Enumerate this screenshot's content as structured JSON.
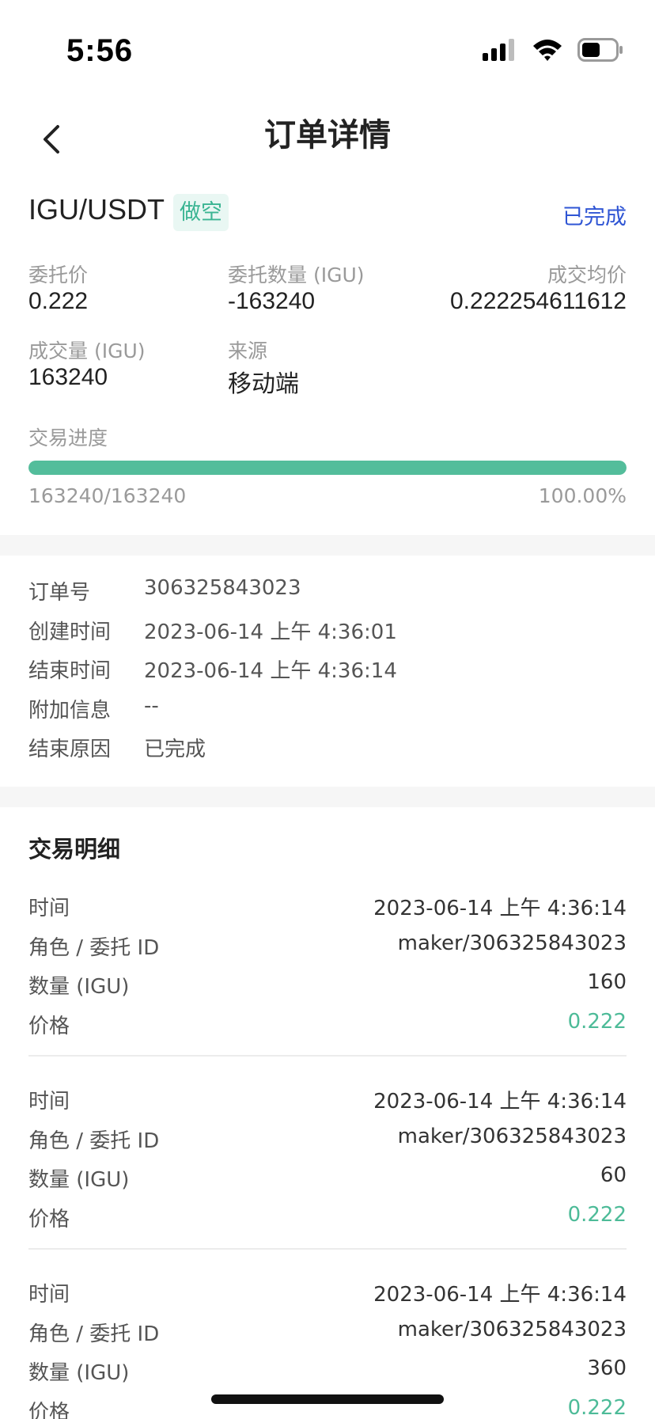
{
  "status": {
    "time": "5:56"
  },
  "nav": {
    "title": "订单详情"
  },
  "order": {
    "pair": "IGU/USDT",
    "side": "做空",
    "status": "已完成",
    "fields": {
      "price_label": "委托价",
      "price": "0.222",
      "qty_label": "委托数量 (IGU)",
      "qty": "-163240",
      "avg_label": "成交均价",
      "avg": "0.222254611612",
      "filled_label": "成交量 (IGU)",
      "filled": "163240",
      "source_label": "来源",
      "source": "移动端"
    },
    "progress": {
      "label": "交易进度",
      "text": "163240/163240",
      "percent_text": "100.00%",
      "fraction": 1.0
    }
  },
  "info": {
    "rows": [
      {
        "label": "订单号",
        "value": "306325843023"
      },
      {
        "label": "创建时间",
        "value": "2023-06-14 上午 4:36:01"
      },
      {
        "label": "结束时间",
        "value": "2023-06-14 上午 4:36:14"
      },
      {
        "label": "附加信息",
        "value": "--"
      },
      {
        "label": "结束原因",
        "value": "已完成"
      }
    ]
  },
  "detail": {
    "title": "交易明细",
    "labels": {
      "time": "时间",
      "role": "角色 / 委托 ID",
      "qty": "数量 (IGU)",
      "price": "价格"
    },
    "trades": [
      {
        "time": "2023-06-14 上午 4:36:14",
        "role": "maker/306325843023",
        "qty": "160",
        "price": "0.222"
      },
      {
        "time": "2023-06-14 上午 4:36:14",
        "role": "maker/306325843023",
        "qty": "60",
        "price": "0.222"
      },
      {
        "time": "2023-06-14 上午 4:36:14",
        "role": "maker/306325843023",
        "qty": "360",
        "price": "0.222"
      }
    ]
  },
  "colors": {
    "accent_green": "#53bd9b",
    "status_blue": "#2f55d4",
    "tag_bg": "#e9f7f3"
  },
  "icons": [
    "signal-icon",
    "wifi-icon",
    "battery-icon",
    "back-arrow-icon"
  ]
}
